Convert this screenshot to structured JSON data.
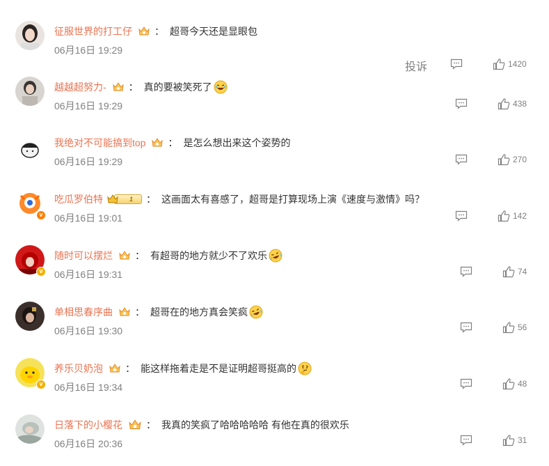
{
  "actions": {
    "report_label": "投诉"
  },
  "colors": {
    "username": "#eb7350",
    "text": "#333333",
    "meta": "#808080"
  },
  "comments": [
    {
      "user": "征服世界的打工仔",
      "sep": "：",
      "text": "超哥今天还是显眼包",
      "time": "06月16日 19:29",
      "likes": "1420",
      "emoji": ""
    },
    {
      "user": "越越超努力-",
      "sep": "：",
      "text": "真的要被笑死了",
      "time": "06月16日 19:29",
      "likes": "438",
      "emoji": "laughing-emoji"
    },
    {
      "user": "我绝对不可能搞到top",
      "sep": "：",
      "text": "是怎么想出来这个姿势的",
      "time": "06月16日 19:29",
      "likes": "270",
      "emoji": ""
    },
    {
      "user": "吃瓜罗伯特",
      "sep": "：",
      "text": "这画面太有喜感了，超哥是打算现场上演《速度与激情》吗？",
      "time": "06月16日 19:01",
      "likes": "142",
      "emoji": "",
      "vip_level": "1"
    },
    {
      "user": "随时可以摆烂",
      "sep": "：",
      "text": "有超哥的地方就少不了欢乐",
      "time": "06月16日 19:31",
      "likes": "74",
      "emoji": "crying-laugh-emoji"
    },
    {
      "user": "单相思春序曲",
      "sep": "：",
      "text": "超哥在的地方真会笑疯",
      "time": "06月16日 19:30",
      "likes": "56",
      "emoji": "crying-laugh-emoji"
    },
    {
      "user": "养乐贝奶泡",
      "sep": "：",
      "text": "能这样拖着走是不是证明超哥挺高的",
      "time": "06月16日 19:34",
      "likes": "48",
      "emoji": "thinking-emoji"
    },
    {
      "user": "日落下的小樱花",
      "sep": "：",
      "text": "我真的笑疯了哈哈哈哈哈 有他在真的很欢乐",
      "time": "06月16日 20:36",
      "likes": "31",
      "emoji": ""
    }
  ]
}
